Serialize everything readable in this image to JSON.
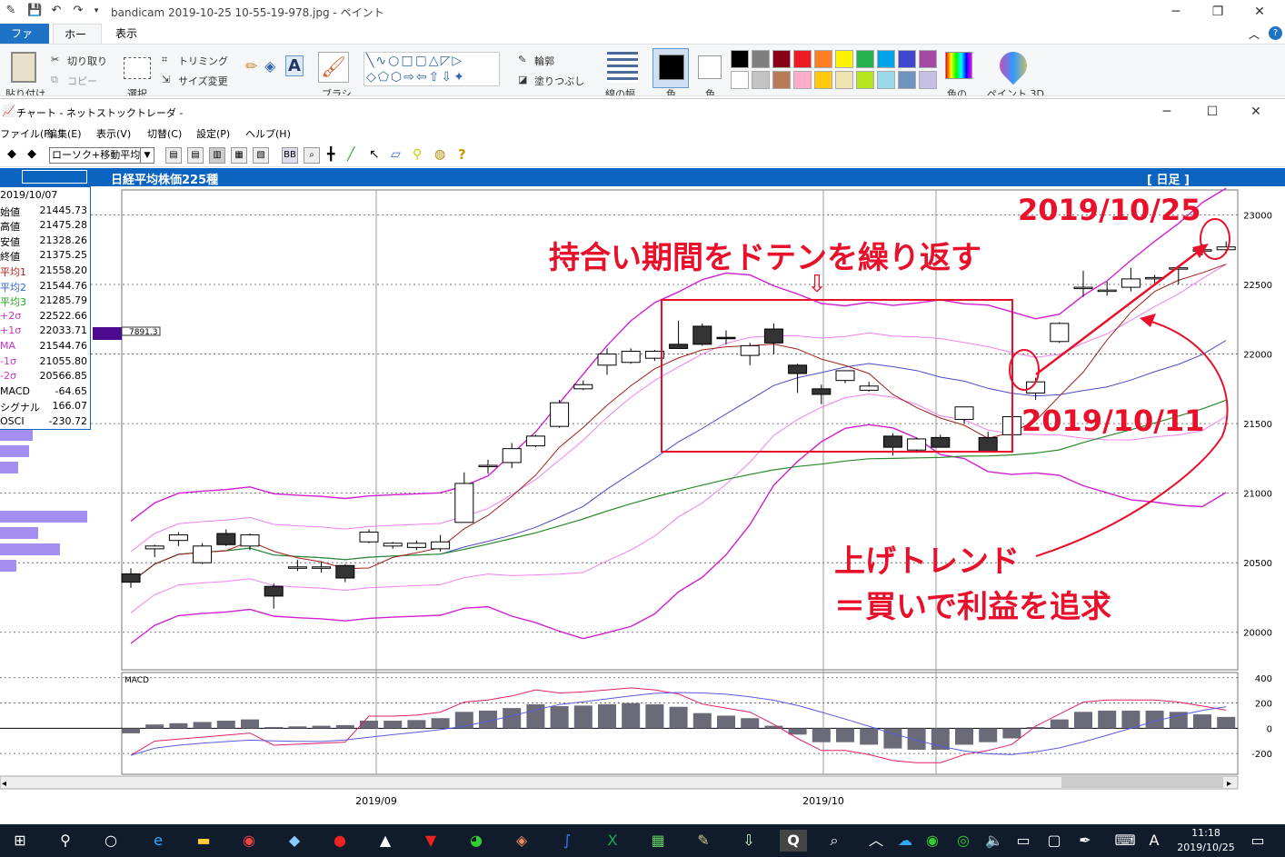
{
  "paint": {
    "title": "bandicam 2019-10-25 10-55-19-978.jpg - ペイント",
    "tabs": {
      "file": "ファイル",
      "home": "ホーム",
      "view": "表示"
    },
    "ribbon": {
      "paste": "貼り付け",
      "cut": "切り取り",
      "copy": "コピー",
      "select": "選択",
      "crop": "トリミング",
      "resize": "サイズ変更",
      "brush": "ブラシ",
      "outline": "輪郭",
      "fill": "塗りつぶし",
      "line_width": "線の幅",
      "color1": "色",
      "color2": "色",
      "edit_colors": "色の",
      "paint3d": "ペイント 3D"
    },
    "palette": [
      "#000000",
      "#7f7f7f",
      "#880015",
      "#ed1c24",
      "#ff7f27",
      "#fff200",
      "#22b14c",
      "#00a2e8",
      "#3f48cc",
      "#a349a4",
      "#ffffff",
      "#c3c3c3",
      "#b97a57",
      "#ffaec9",
      "#ffc90e",
      "#efe4b0",
      "#b5e61d",
      "#99d9ea",
      "#7092be",
      "#c8bfe7"
    ]
  },
  "app": {
    "title": "チャート - ネットストックトレーダ -",
    "menu": [
      "ファイル(F)",
      "編集(E)",
      "表示(V)",
      "切替(C)",
      "設定(P)",
      "ヘルプ(H)"
    ],
    "chart_type": "ローソク+移動平均",
    "header_title": "日経平均株価225種",
    "period": "[ 日足 ]",
    "side_value": "7891.3"
  },
  "info": [
    {
      "k": "2019/10/07",
      "v": ""
    },
    {
      "k": "始値",
      "v": "21445.73"
    },
    {
      "k": "高値",
      "v": "21475.28"
    },
    {
      "k": "安値",
      "v": "21328.26"
    },
    {
      "k": "終値",
      "v": "21375.25"
    },
    {
      "k": "平均1",
      "v": "21558.20"
    },
    {
      "k": "平均2",
      "v": "21544.76"
    },
    {
      "k": "平均3",
      "v": "21285.79"
    },
    {
      "k": "+2σ",
      "v": "22522.66"
    },
    {
      "k": "+1σ",
      "v": "22033.71"
    },
    {
      "k": "MA",
      "v": "21544.76"
    },
    {
      "k": "-1σ",
      "v": "21055.80"
    },
    {
      "k": "-2σ",
      "v": "20566.85"
    },
    {
      "k": "MACD",
      "v": "-64.65"
    },
    {
      "k": "シグナル",
      "v": "166.07"
    },
    {
      "k": "OSCI",
      "v": "-230.72"
    }
  ],
  "annotations": {
    "top_date": "2019/10/25",
    "range_note": "持合い期間をドテンを繰り返す",
    "arrow_down": "⇩",
    "mid_date": "2019/10/11",
    "trend1": "上げトレンド",
    "trend2": "＝買いで利益を追求"
  },
  "chart_data": {
    "type": "candlestick",
    "price_axis": {
      "ticks": [
        20000,
        20500,
        21000,
        21500,
        22000,
        22500,
        23000
      ],
      "range": [
        19750,
        23160
      ]
    },
    "macd_axis": {
      "ticks": [
        400,
        200,
        0,
        -200
      ],
      "range": [
        -350,
        420
      ]
    },
    "x_labels": [
      "2019/09",
      "2019/10"
    ],
    "macd_label": "MACD",
    "candles": [
      [
        20420,
        20460,
        20320,
        20360
      ],
      [
        20600,
        20630,
        20540,
        20620
      ],
      [
        20660,
        20720,
        20620,
        20700
      ],
      [
        20500,
        20640,
        20490,
        20620
      ],
      [
        20710,
        20740,
        20620,
        20630
      ],
      [
        20620,
        20710,
        20590,
        20700
      ],
      [
        20330,
        20350,
        20170,
        20260
      ],
      [
        20460,
        20520,
        20440,
        20470
      ],
      [
        20460,
        20510,
        20430,
        20470
      ],
      [
        20480,
        20490,
        20360,
        20390
      ],
      [
        20650,
        20740,
        20640,
        20720
      ],
      [
        20620,
        20650,
        20600,
        20640
      ],
      [
        20610,
        20660,
        20590,
        20640
      ],
      [
        20600,
        20700,
        20580,
        20650
      ],
      [
        20790,
        21150,
        20790,
        21070
      ],
      [
        21190,
        21240,
        21140,
        21200
      ],
      [
        21220,
        21360,
        21180,
        21320
      ],
      [
        21340,
        21420,
        21330,
        21410
      ],
      [
        21480,
        21670,
        21470,
        21650
      ],
      [
        21750,
        21810,
        21740,
        21780
      ],
      [
        21920,
        22040,
        21850,
        22000
      ],
      [
        21940,
        22040,
        21930,
        22020
      ],
      [
        21970,
        22030,
        21950,
        22020
      ],
      [
        22070,
        22240,
        22050,
        22040
      ],
      [
        22200,
        22220,
        22060,
        22070
      ],
      [
        22120,
        22170,
        22070,
        22110
      ],
      [
        21990,
        22080,
        21920,
        22060
      ],
      [
        22180,
        22220,
        22000,
        22080
      ],
      [
        21920,
        21930,
        21720,
        21860
      ],
      [
        21750,
        21780,
        21640,
        21710
      ],
      [
        21810,
        21880,
        21790,
        21880
      ],
      [
        21740,
        21800,
        21730,
        21770
      ],
      [
        21410,
        21430,
        21270,
        21330
      ],
      [
        21310,
        21400,
        21290,
        21390
      ],
      [
        21400,
        21420,
        21340,
        21330
      ],
      [
        21530,
        21590,
        21500,
        21620
      ],
      [
        21400,
        21440,
        21320,
        21300
      ],
      [
        21420,
        21620,
        21290,
        21550
      ],
      [
        21720,
        21830,
        21670,
        21800
      ],
      [
        22090,
        22230,
        22080,
        22220
      ],
      [
        22470,
        22600,
        22410,
        22480
      ],
      [
        22460,
        22520,
        22420,
        22460
      ],
      [
        22480,
        22620,
        22450,
        22540
      ],
      [
        22550,
        22570,
        22510,
        22550
      ],
      [
        22620,
        22630,
        22500,
        22620
      ],
      [
        22740,
        22790,
        22710,
        22750
      ],
      [
        22750,
        22810,
        22720,
        22770
      ]
    ],
    "macd_hist": [
      -40,
      30,
      40,
      50,
      60,
      70,
      10,
      15,
      20,
      25,
      60,
      60,
      65,
      80,
      130,
      140,
      160,
      190,
      175,
      180,
      190,
      200,
      190,
      170,
      120,
      100,
      80,
      20,
      -50,
      -110,
      -110,
      -130,
      -160,
      -170,
      -170,
      -130,
      -110,
      -80,
      10,
      70,
      130,
      140,
      140,
      140,
      130,
      110,
      90
    ]
  }
}
